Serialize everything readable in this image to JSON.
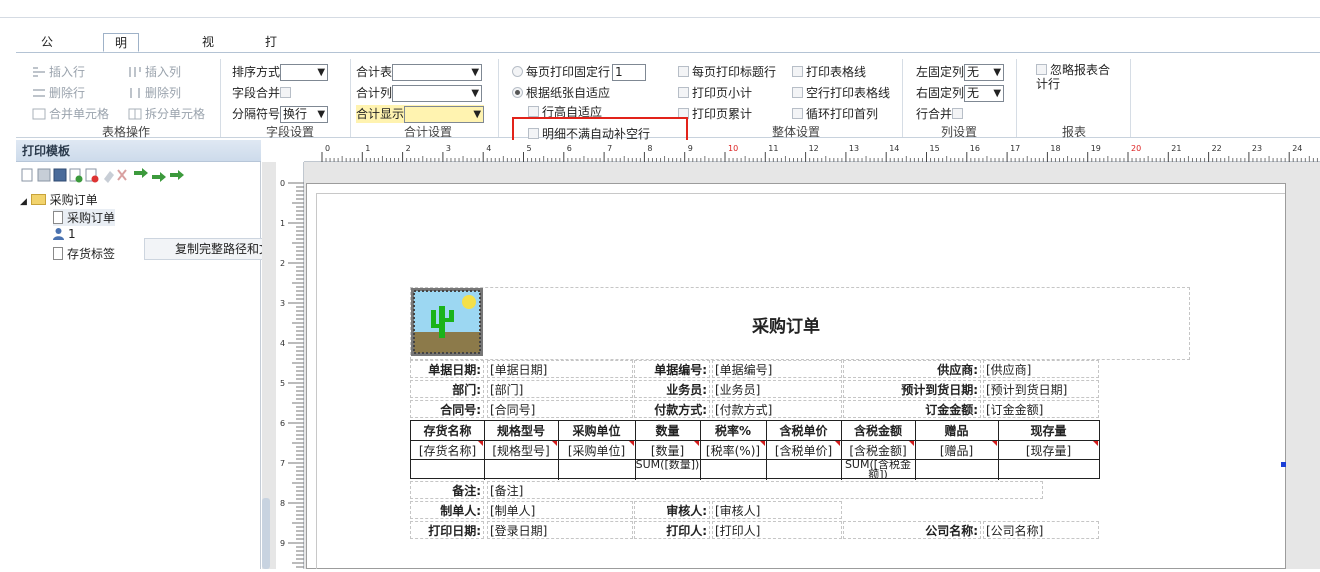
{
  "tabs": [
    {
      "label": "公共操作"
    },
    {
      "label": "明细设置"
    },
    {
      "label": "视图"
    },
    {
      "label": "打印设置"
    }
  ],
  "ribbon": {
    "table_ops": {
      "insert_row": "插入行",
      "insert_col": "插入列",
      "delete_row": "删除行",
      "delete_col": "删除列",
      "merge_cells": "合并单元格",
      "split_cells": "拆分单元格",
      "label": "表格操作"
    },
    "field_settings": {
      "sort_label": "排序方式",
      "sort_value": "",
      "field_merge": "字段合并",
      "separator_label": "分隔符号",
      "separator_value": "换行",
      "label": "字段设置"
    },
    "total_settings": {
      "total_table": "合计表",
      "total_table_value": "",
      "total_col": "合计列",
      "total_col_value": "",
      "total_display": "合计显示",
      "total_display_value": "",
      "label": "合计设置"
    },
    "overall": {
      "fixed_rows": "每页打印固定行",
      "fixed_rows_value": "1",
      "fit_paper": "根据纸张自适应",
      "row_height_fit": "行高自适应",
      "no_auto_fill": "明细不满自动补空行",
      "title_row": "每页打印标题行",
      "page_subtotal": "打印页小计",
      "page_cumulative": "打印页累计",
      "print_gridlines": "打印表格线",
      "blank_gridlines": "空行打印表格线",
      "loop_first_col": "循环打印首列",
      "label": "整体设置"
    },
    "col_settings": {
      "left_fixed": "左固定列",
      "left_fixed_value": "无",
      "right_fixed": "右固定列",
      "right_fixed_value": "无",
      "row_merge": "行合并",
      "label": "列设置"
    },
    "report": {
      "ignore_total": "忽略报表合计行",
      "label": "报表"
    }
  },
  "left_panel": {
    "title": "打印模板",
    "tree": {
      "root": "采购订单",
      "items": [
        "采购订单",
        "1",
        "存货标签"
      ]
    },
    "context_menu": "复制完整路径和文件名到剪贴板(F)"
  },
  "ruler": {
    "h_ticks": [
      "0",
      "1",
      "2",
      "3",
      "4",
      "5",
      "6",
      "7",
      "8",
      "9",
      "10",
      "11",
      "12",
      "13",
      "14",
      "15",
      "16",
      "17",
      "18",
      "19",
      "20",
      "21",
      "22",
      "23",
      "24"
    ],
    "v_ticks": [
      "0",
      "1",
      "2",
      "3",
      "4",
      "5",
      "6",
      "7",
      "8",
      "9"
    ]
  },
  "report": {
    "title": "采购订单",
    "header": [
      {
        "label": "单据日期:",
        "value": "[单据日期]",
        "label2": "单据编号:",
        "value2": "[单据编号]",
        "label3": "供应商:",
        "value3": "[供应商]"
      },
      {
        "label": "部门:",
        "value": "[部门]",
        "label2": "业务员:",
        "value2": "[业务员]",
        "label3": "预计到货日期:",
        "value3": "[预计到货日期]"
      },
      {
        "label": "合同号:",
        "value": "[合同号]",
        "label2": "付款方式:",
        "value2": "[付款方式]",
        "label3": "订金金额:",
        "value3": "[订金金额]"
      }
    ],
    "columns": [
      "存货名称",
      "规格型号",
      "采购单位",
      "数量",
      "税率%",
      "含税单价",
      "含税金额",
      "赠品",
      "现存量"
    ],
    "row": [
      "[存货名称]",
      "[规格型号]",
      "[采购单位]",
      "[数量]",
      "[税率(%)]",
      "[含税单价]",
      "[含税金额]",
      "[赠品]",
      "[现存量]"
    ],
    "sum_row": [
      "",
      "",
      "",
      "SUM([数量])",
      "",
      "",
      "SUM([含税金额])",
      "",
      ""
    ],
    "footer": [
      {
        "label": "备注:",
        "value": "[备注]"
      },
      {
        "label": "制单人:",
        "value": "[制单人]",
        "label2": "审核人:",
        "value2": "[审核人]"
      },
      {
        "label": "打印日期:",
        "value": "[登录日期]",
        "label2": "打印人:",
        "value2": "[打印人]",
        "label3": "公司名称:",
        "value3": "[公司名称]"
      }
    ]
  }
}
